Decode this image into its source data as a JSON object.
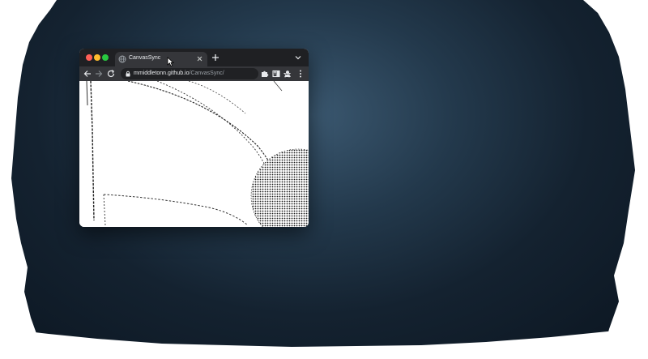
{
  "browser": {
    "tab": {
      "title": "CanvasSync",
      "favicon": "globe-icon"
    },
    "new_tab_icon": "plus-icon",
    "tab_menu_icon": "chevron-down-icon",
    "toolbar": {
      "url_host": "mmiddletonn.github.io",
      "url_path": "/CanvasSync/"
    }
  },
  "colors": {
    "close": "#ff5f57",
    "minimize": "#febc2e",
    "maximize": "#28c840",
    "chrome_dark": "#1f2023",
    "chrome_tab": "#35363a",
    "canvas": "#ffffff"
  }
}
